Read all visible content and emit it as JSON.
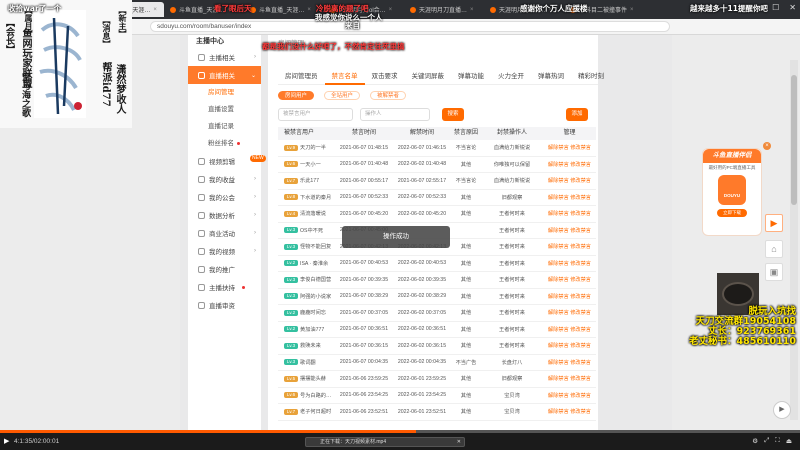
{
  "browser": {
    "tabs": [
      {
        "label": "斗鱼直播_天涯明月…",
        "active": false
      },
      {
        "label": "天涯明月刀_天涯…",
        "active": true
      },
      {
        "label": "斗鱼直播_天涯…",
        "active": false
      },
      {
        "label": "斗鱼直播_天涯…",
        "active": false
      },
      {
        "label": "天涯明月刀ol合…",
        "active": false
      },
      {
        "label": "天涯明月刀直播…",
        "active": false
      },
      {
        "label": "天涯明月刀ol合…",
        "active": false
      },
      {
        "label": "考科目二被撞事件",
        "active": false
      }
    ],
    "url": "sdouyu.com/room/banuser/index",
    "window_controls": [
      "—",
      "☐",
      "✕"
    ]
  },
  "sidebar": {
    "title": "主播中心",
    "items": [
      {
        "label": "主播相关",
        "icon": "user-icon",
        "chevron": "›"
      },
      {
        "label": "直播相关",
        "icon": "video-icon",
        "chevron": "⌄",
        "open": true
      },
      {
        "label": "房间管理",
        "sub": true,
        "active": true
      },
      {
        "label": "直播设置",
        "sub": true
      },
      {
        "label": "直播记录",
        "sub": true
      },
      {
        "label": "粉丝排名",
        "sub": true,
        "dot": true
      },
      {
        "label": "视频剪辑",
        "icon": "scissors-icon",
        "badge": "NEW"
      },
      {
        "label": "我的收益",
        "icon": "wallet-icon",
        "chevron": "›"
      },
      {
        "label": "我的公会",
        "icon": "group-icon",
        "chevron": "›"
      },
      {
        "label": "数据分析",
        "icon": "chart-icon",
        "chevron": "›"
      },
      {
        "label": "商业活动",
        "icon": "flag-icon",
        "chevron": "›"
      },
      {
        "label": "我的视频",
        "icon": "film-icon",
        "chevron": "›"
      },
      {
        "label": "我的推广",
        "icon": "megaphone-icon"
      },
      {
        "label": "主播扶持",
        "icon": "hand-icon",
        "dot": true
      },
      {
        "label": "直播审资",
        "icon": "doc-icon"
      }
    ]
  },
  "main": {
    "crumb": "房间管理",
    "tabs": [
      "房间管理员",
      "禁言名单",
      "双击要求",
      "关键词屏蔽",
      "弹幕功能",
      "火力全开",
      "弹幕热词",
      "精彩时刻"
    ],
    "active_tab": 1,
    "subtabs": [
      "房间用户",
      "全站用户",
      "被解禁者"
    ],
    "filter": {
      "user_placeholder": "被禁言用户",
      "op_placeholder": "操作人",
      "search_label": "搜索",
      "add_label": "添加"
    },
    "table": {
      "headers": [
        "被禁言用户",
        "禁言时间",
        "解禁时间",
        "禁言原因",
        "封禁操作人",
        "管理"
      ],
      "op_label": "解除禁言 修改禁言",
      "rows": [
        {
          "lvl": "Lv.9",
          "lc": "o",
          "user": "天刀的一半",
          "ban": "2021-06-07 01:48:15",
          "unban": "2022-06-07 01:46:15",
          "reason": "不当言论",
          "op": "血满给力新锐说"
        },
        {
          "lvl": "Lv.6",
          "lc": "o",
          "user": "一天小一",
          "ban": "2021-06-07 01:40:48",
          "unban": "2022-06-02 01:40:48",
          "reason": "其他",
          "op": "你唯独可以保留"
        },
        {
          "lvl": "Lv.7",
          "lc": "o",
          "user": "乐此177",
          "ban": "2021-06-07 00:55:17",
          "unban": "2021-06-07 02:55:17",
          "reason": "不当言论",
          "op": "血满给力新锐说"
        },
        {
          "lvl": "Lv.8",
          "lc": "o",
          "user": "下水道的秦月",
          "ban": "2021-06-07 00:52:33",
          "unban": "2022-06-07 00:52:33",
          "reason": "其他",
          "op": "旧都观察"
        },
        {
          "lvl": "Lv.4",
          "lc": "o",
          "user": "清流落暖说",
          "ban": "2021-06-07 00:45:20",
          "unban": "2022-06-02 00:45:20",
          "reason": "其他",
          "op": "王者何时来"
        },
        {
          "lvl": "Lv.3",
          "lc": "g",
          "user": "OS中不死",
          "ban": "2021-06-07 00:45:00",
          "unban": "",
          "reason": "",
          "op": "王者何时来"
        },
        {
          "lvl": "Lv.3",
          "lc": "g",
          "user": "怪物不能回复",
          "ban": "2021-06-07 00:42:13",
          "unban": "2022-06-02 00:42:13",
          "reason": "其他",
          "op": "王者何时来"
        },
        {
          "lvl": "Lv.2",
          "lc": "g",
          "user": "ISA · 秦淮余",
          "ban": "2021-06-07 00:40:53",
          "unban": "2022-06-02 00:40:53",
          "reason": "其他",
          "op": "王者何时来"
        },
        {
          "lvl": "Lv.3",
          "lc": "g",
          "user": "李俊白德国营",
          "ban": "2021-06-07 00:39:35",
          "unban": "2022-06-02 00:39:35",
          "reason": "其他",
          "op": "王者何时来"
        },
        {
          "lvl": "Lv.3",
          "lc": "g",
          "user": "阿强的小说家",
          "ban": "2021-06-07 00:38:29",
          "unban": "2022-06-02 00:38:29",
          "reason": "其他",
          "op": "王者何时来"
        },
        {
          "lvl": "Lv.2",
          "lc": "g",
          "user": "鹿鹿时间忘",
          "ban": "2021-06-07 00:37:05",
          "unban": "2022-06-02 00:37:05",
          "reason": "其他",
          "op": "王者何时来"
        },
        {
          "lvl": "Lv.2",
          "lc": "g",
          "user": "黄加油777",
          "ban": "2021-06-07 00:36:51",
          "unban": "2022-06-02 00:36:51",
          "reason": "其他",
          "op": "王者何时来"
        },
        {
          "lvl": "Lv.3",
          "lc": "g",
          "user": "救赎未来",
          "ban": "2021-06-07 00:36:15",
          "unban": "2022-06-02 00:36:15",
          "reason": "其他",
          "op": "王者何时来"
        },
        {
          "lvl": "Lv.3",
          "lc": "g",
          "user": "歌词翻",
          "ban": "2021-06-07 00:04:35",
          "unban": "2022-06-02 00:04:35",
          "reason": "不当广告",
          "op": "长盘灯八"
        },
        {
          "lvl": "Lv.5",
          "lc": "o",
          "user": "摆摆能头赫",
          "ban": "2021-06-06 23:59:25",
          "unban": "2022-06-01 23:59:25",
          "reason": "其他",
          "op": "旧都观察"
        },
        {
          "lvl": "Lv.6",
          "lc": "o",
          "user": "号为白路的时光",
          "ban": "2021-06-06 23:54:25",
          "unban": "2022-06-01 23:54:25",
          "reason": "其他",
          "op": "宝贝湾"
        },
        {
          "lvl": "Lv.7",
          "lc": "o",
          "user": "老子何日超时",
          "ban": "2021-06-06 23:52:51",
          "unban": "2022-06-01 23:52:51",
          "reason": "其他",
          "op": "宝贝湾"
        }
      ]
    }
  },
  "toast": "操作成功",
  "promo": {
    "title": "斗鱼直播伴侣",
    "subtitle": "最好用的PC端直播工具",
    "logo": "DOUYU",
    "button": "立即下载"
  },
  "overlay": {
    "danmaku": [
      {
        "text": "收拾war了一个",
        "red": false
      },
      {
        "text": "看了眼后天",
        "red": true
      },
      {
        "text": "冷脱离的题了吧",
        "red": true
      },
      {
        "text": "我感觉你说么一个人",
        "red": false
      },
      {
        "text": "来自",
        "red": false
      },
      {
        "text": "感谢你个万人应援楼",
        "red": false
      },
      {
        "text": "越来越多十11提醒你吧",
        "red": false
      },
      {
        "text": "都是我们没什么好吧了，不然肯定往死里搞",
        "red": true
      }
    ],
    "left_vertical": [
      "鱼",
      "网",
      "玩",
      "家",
      "联",
      "盟"
    ],
    "left_vertical_2": [
      "空",
      "与",
      "海",
      "之",
      "歌"
    ],
    "right_vertical": [
      "潇",
      "然",
      "梦",
      "收",
      "人"
    ],
    "right_vertical_2": [
      "帮",
      "派",
      "id",
      "77"
    ],
    "bracket_labels": [
      "【会长】",
      "【属月】",
      "【消息】",
      "【新主】"
    ],
    "calligraphy": "空海之歌",
    "qq_lines": [
      "脱玩入坑找",
      "天刀交流群19054108",
      "丈长：923769361",
      "老丈秘书：485610110"
    ]
  },
  "player": {
    "time": "4:1:35/02:00:01",
    "progress": 0.52,
    "controls": [
      "⚙",
      "⤢",
      "⛶",
      "⏏"
    ]
  },
  "download": "正在下载：天刀视频素材.mp4"
}
